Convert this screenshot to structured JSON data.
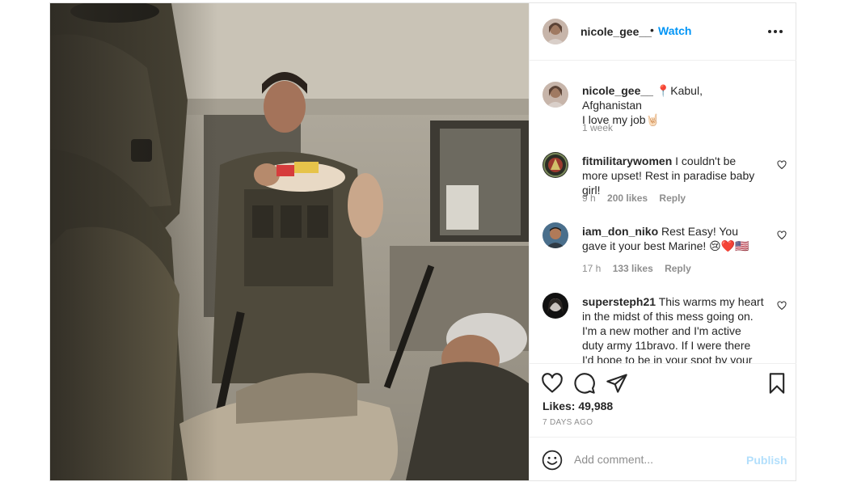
{
  "post": {
    "username": "nicole_gee__",
    "separator": "•",
    "watch_label": "Watch",
    "more_icon": "more-horizontal-icon",
    "photo_alt": "photo"
  },
  "caption": {
    "username": "nicole_gee__",
    "location_icon": "📍",
    "location": "Kabul, Afghanistan",
    "text": "I love my job",
    "emoji": "🤘🏻",
    "time": "1 week"
  },
  "comments": [
    {
      "username": "fitmilitarywomen",
      "text": "I couldn't be more upset! Rest in paradise baby girl!",
      "time": "9 h",
      "likes": "200 likes",
      "reply": "Reply"
    },
    {
      "username": "iam_don_niko",
      "text": "Rest Easy! You gave it your best Marine! 😢❤️🇺🇸",
      "time": "17 h",
      "likes": "133 likes",
      "reply": "Reply"
    },
    {
      "username": "supersteph21",
      "text": "This warms my heart in the midst of this mess going on. I'm a new mother and I'm active duty army 11bravo. If I were there I'd hope to be in your spot by your side. This",
      "time": "",
      "likes": "",
      "reply": ""
    }
  ],
  "actions": {
    "like_icon": "heart-icon",
    "comment_icon": "comment-icon",
    "share_icon": "share-icon",
    "save_icon": "bookmark-icon",
    "likes_label": "Likes:",
    "likes_count": "49,988",
    "posted_ago": "7 DAYS AGO"
  },
  "add_comment": {
    "emoji_icon": "smiley-icon",
    "placeholder": "Add comment...",
    "publish_label": "Publish"
  },
  "colors": {
    "accent": "#0095f6",
    "publish_disabled": "#b2dffc",
    "text": "#262626",
    "muted": "#8e8e8e",
    "border": "#efefef"
  }
}
